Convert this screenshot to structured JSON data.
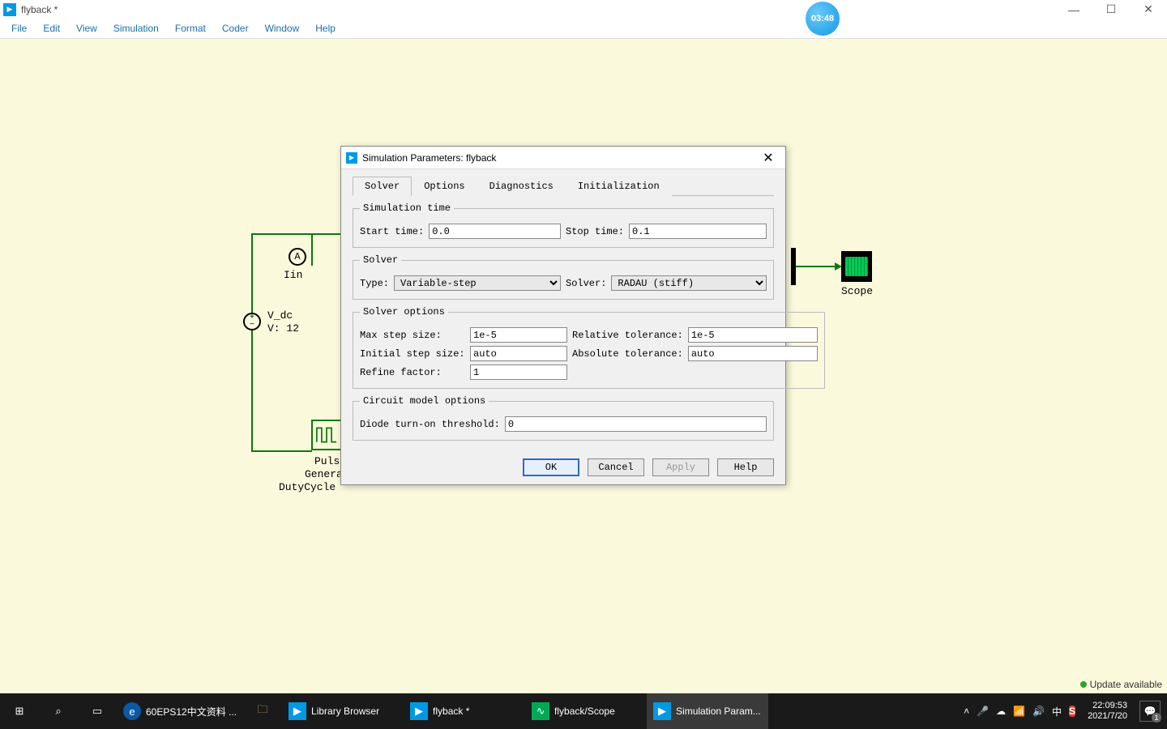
{
  "window": {
    "title": "flyback *"
  },
  "menu": {
    "items": [
      "File",
      "Edit",
      "View",
      "Simulation",
      "Format",
      "Coder",
      "Window",
      "Help"
    ]
  },
  "timer": "03:48",
  "circuit": {
    "ammeter_label": "A",
    "iin_label": "Iin",
    "vdc_label1": "V_dc",
    "vdc_label2": "V: 12",
    "pulse_label1": "Puls",
    "pulse_label2": "Genera",
    "pulse_label3": "DutyCycle",
    "scope_label": "Scope"
  },
  "dialog": {
    "title": "Simulation Parameters: flyback",
    "tabs": [
      "Solver",
      "Options",
      "Diagnostics",
      "Initialization"
    ],
    "group_sim_time": "Simulation time",
    "start_time_label": "Start time:",
    "start_time": "0.0",
    "stop_time_label": "Stop time:",
    "stop_time": "0.1",
    "group_solver": "Solver",
    "type_label": "Type:",
    "type": "Variable-step",
    "solver_label": "Solver:",
    "solver": "RADAU (stiff)",
    "group_solver_opts": "Solver options",
    "max_step_label": "Max step size:",
    "max_step": "1e-5",
    "rel_tol_label": "Relative tolerance:",
    "rel_tol": "1e-5",
    "init_step_label": "Initial step size:",
    "init_step": "auto",
    "abs_tol_label": "Absolute tolerance:",
    "abs_tol": "auto",
    "refine_label": "Refine factor:",
    "refine": "1",
    "group_circuit": "Circuit model options",
    "diode_label": "Diode turn-on threshold:",
    "diode": "0",
    "btn_ok": "OK",
    "btn_cancel": "Cancel",
    "btn_apply": "Apply",
    "btn_help": "Help"
  },
  "update": "Update available",
  "taskbar": {
    "apps": {
      "edge": "60EPS12中文资料 ...",
      "lib": "Library Browser",
      "flyback": "flyback *",
      "scope": "flyback/Scope",
      "sim": "Simulation Param..."
    },
    "ime": "中",
    "time": "22:09:53",
    "date": "2021/7/20"
  }
}
